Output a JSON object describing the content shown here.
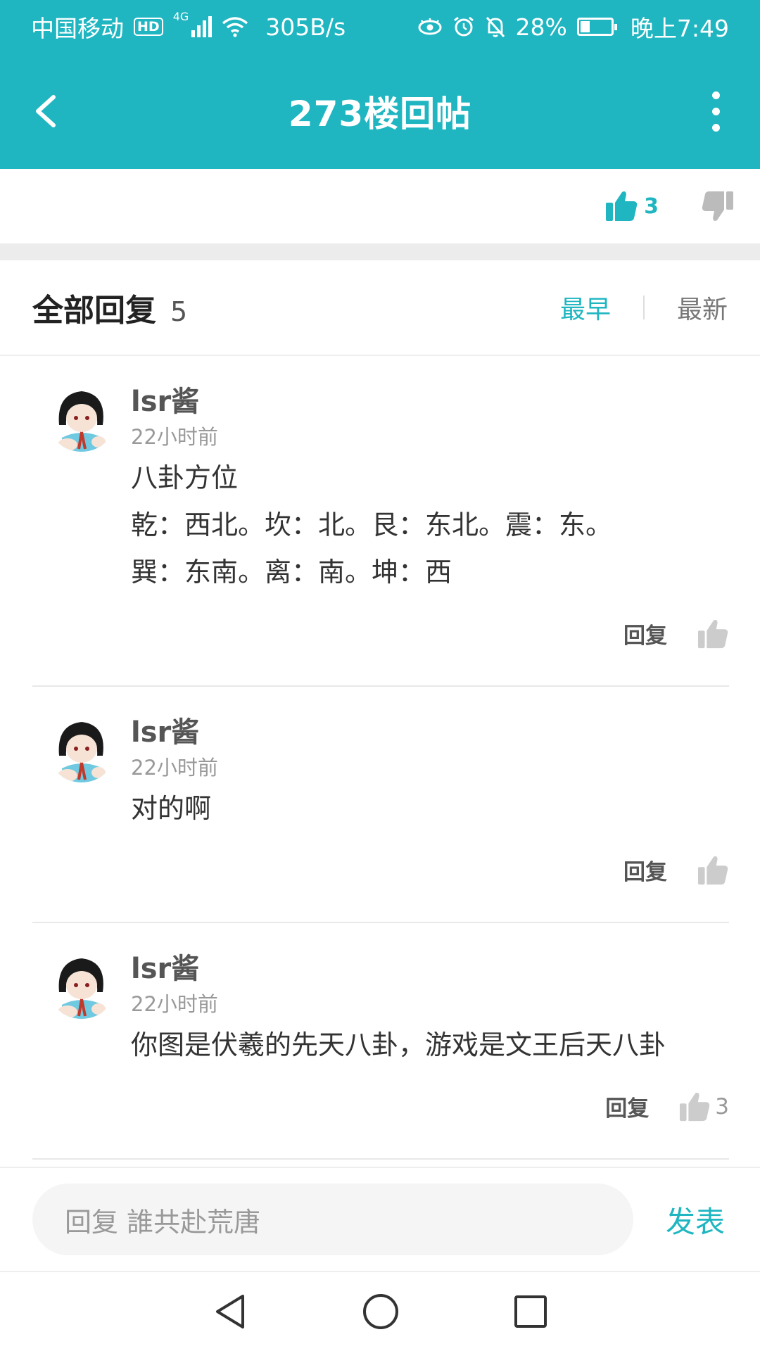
{
  "status_bar": {
    "carrier": "中国移动",
    "hd_badge": "HD",
    "network": "4G",
    "speed": "305B/s",
    "battery": "28%",
    "time": "晚上7:49"
  },
  "app_bar": {
    "title": "273楼回帖"
  },
  "post_votes": {
    "likes": "3"
  },
  "replies_header": {
    "title": "全部回复",
    "count": "5",
    "sort_earliest": "最早",
    "sort_latest": "最新"
  },
  "replies": [
    {
      "username": "lsr酱",
      "time": "22小时前",
      "lines": [
        "八卦方位",
        "乾：西北。坎：北。艮：东北。震：东。",
        "巽：东南。离：南。坤：西"
      ],
      "reply_label": "回复",
      "likes": ""
    },
    {
      "username": "lsr酱",
      "time": "22小时前",
      "lines": [
        "对的啊"
      ],
      "reply_label": "回复",
      "likes": ""
    },
    {
      "username": "lsr酱",
      "time": "22小时前",
      "lines": [
        "你图是伏羲的先天八卦，游戏是文王后天八卦"
      ],
      "reply_label": "回复",
      "likes": "3"
    }
  ],
  "composer": {
    "placeholder": "回复 誰共赴荒唐",
    "send_label": "发表"
  },
  "colors": {
    "accent": "#1fb6c1"
  }
}
